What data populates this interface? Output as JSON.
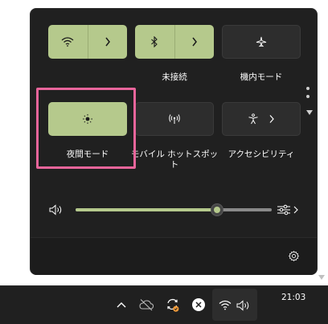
{
  "quick_settings": {
    "tiles": [
      {
        "label": "",
        "state": "on",
        "icon": "wifi-icon",
        "has_arrow": true
      },
      {
        "label": "未接続",
        "state": "on",
        "icon": "bluetooth-icon",
        "has_arrow": true
      },
      {
        "label": "機内モード",
        "state": "off",
        "icon": "airplane-icon",
        "has_arrow": false
      },
      {
        "label": "夜間モード",
        "state": "on",
        "icon": "night-light-icon",
        "has_arrow": false
      },
      {
        "label": "モバイル ホットスポット",
        "state": "off",
        "icon": "hotspot-icon",
        "has_arrow": false
      },
      {
        "label": "アクセシビリティ",
        "state": "off",
        "icon": "accessibility-icon",
        "has_arrow": true
      }
    ],
    "volume": {
      "icon": "speaker-icon",
      "level_percent": 72,
      "output_icon": "audio-output-icon"
    },
    "footer": {
      "icon": "gear-icon"
    },
    "colors": {
      "accent": "#b5c98c",
      "highlight": "#e8659b",
      "panel": "#202020"
    }
  },
  "taskbar": {
    "icons": [
      "chevron-up-icon",
      "cloud-off-icon",
      "sync-icon",
      "close-circle-icon",
      "wifi-icon",
      "speaker-icon"
    ],
    "clock": "21:03"
  }
}
